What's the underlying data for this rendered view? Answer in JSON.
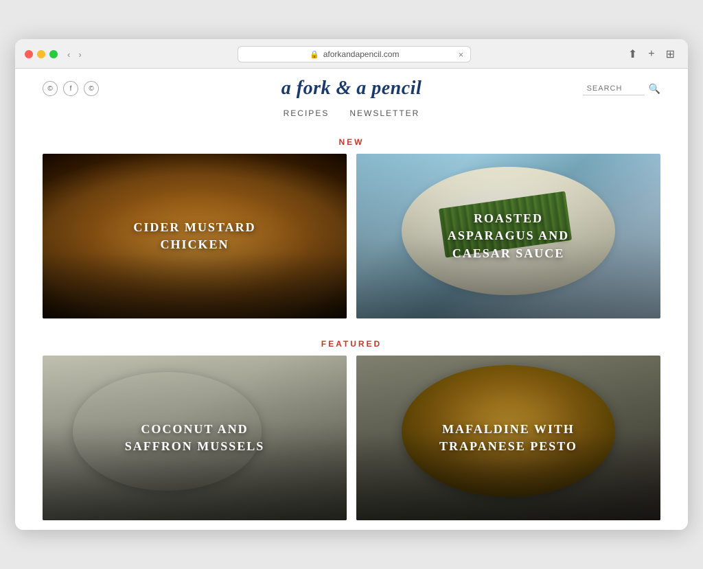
{
  "browser": {
    "tab_title": "aforkandapencil.com",
    "address": "aforkandapencil.com",
    "close_label": "×",
    "back_label": "‹",
    "forward_label": "›"
  },
  "site": {
    "title": "a fork & a pencil",
    "social": {
      "icons": [
        "©",
        "f",
        "©"
      ]
    },
    "search_placeholder": "SEARCH",
    "nav": [
      {
        "label": "RECIPES"
      },
      {
        "label": "NEWSLETTER"
      }
    ]
  },
  "sections": {
    "new": {
      "label": "NEW",
      "recipes": [
        {
          "id": "chicken",
          "title": "CIDER MUSTARD\nCHICKEN",
          "theme": "chicken"
        },
        {
          "id": "asparagus",
          "title": "ROASTED\nASPARAGUS AND\nCAESAR SAUCE",
          "theme": "asparagus"
        }
      ]
    },
    "featured": {
      "label": "FEATURED",
      "recipes": [
        {
          "id": "mussels",
          "title": "COCONUT AND\nSAFFRON MUSSELS",
          "theme": "mussels"
        },
        {
          "id": "pasta",
          "title": "MAFALDINE WITH\nTRAPANESE PESTO",
          "theme": "pasta"
        }
      ]
    }
  }
}
